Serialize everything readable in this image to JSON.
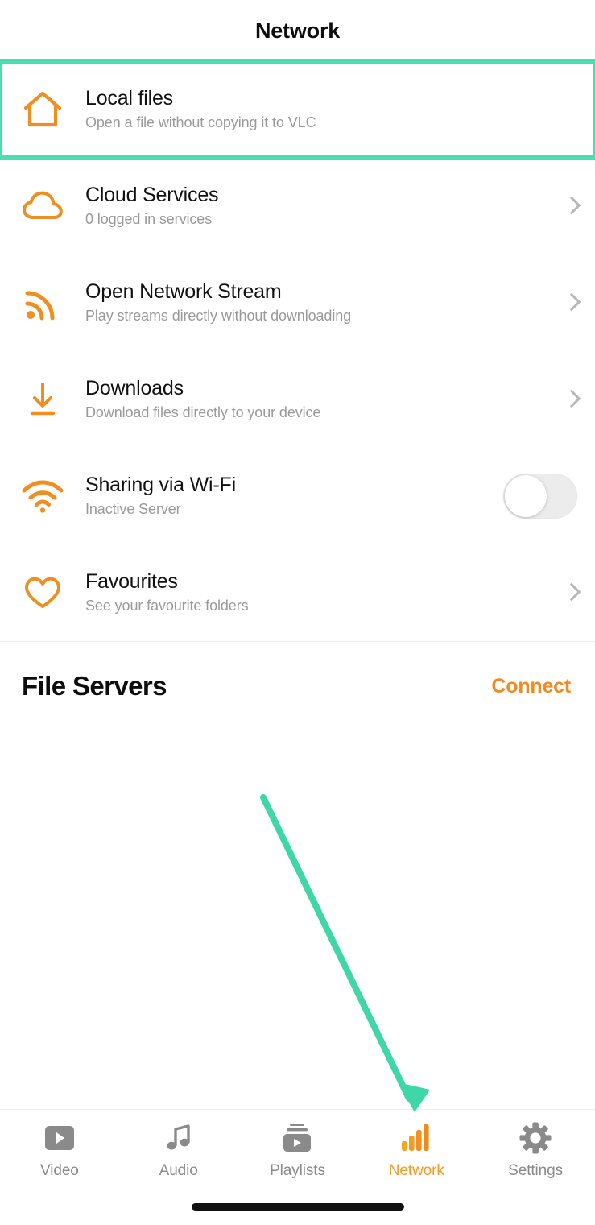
{
  "header": {
    "title": "Network"
  },
  "colors": {
    "accent_orange": "#f08b22",
    "icon_orange": "#ef8f22",
    "highlight_green": "#49dfb0",
    "muted_gray": "#9a9a9a",
    "tab_inactive": "#8a8a8a"
  },
  "list": {
    "items": [
      {
        "id": "local-files",
        "icon": "home-icon",
        "title": "Local files",
        "subtitle": "Open a file without copying it to VLC",
        "accessory": "none",
        "highlighted": true
      },
      {
        "id": "cloud-services",
        "icon": "cloud-icon",
        "title": "Cloud Services",
        "subtitle": "0 logged in services",
        "accessory": "chevron",
        "highlighted": false
      },
      {
        "id": "open-network-stream",
        "icon": "stream-icon",
        "title": "Open Network Stream",
        "subtitle": "Play streams directly without downloading",
        "accessory": "chevron",
        "highlighted": false
      },
      {
        "id": "downloads",
        "icon": "download-icon",
        "title": "Downloads",
        "subtitle": "Download files directly to your device",
        "accessory": "chevron",
        "highlighted": false
      },
      {
        "id": "sharing-via-wifi",
        "icon": "wifi-icon",
        "title": "Sharing via Wi-Fi",
        "subtitle": "Inactive Server",
        "accessory": "toggle",
        "toggle_state": "off",
        "highlighted": false
      },
      {
        "id": "favourites",
        "icon": "heart-icon",
        "title": "Favourites",
        "subtitle": "See your favourite folders",
        "accessory": "chevron",
        "highlighted": false
      }
    ]
  },
  "file_servers": {
    "title": "File Servers",
    "connect_label": "Connect"
  },
  "tabbar": {
    "tabs": [
      {
        "id": "video",
        "label": "Video",
        "icon": "video-icon",
        "active": false
      },
      {
        "id": "audio",
        "label": "Audio",
        "icon": "audio-note-icon",
        "active": false
      },
      {
        "id": "playlists",
        "label": "Playlists",
        "icon": "playlists-icon",
        "active": false
      },
      {
        "id": "network",
        "label": "Network",
        "icon": "signal-bars-icon",
        "active": true
      },
      {
        "id": "settings",
        "label": "Settings",
        "icon": "gear-icon",
        "active": false
      }
    ]
  },
  "annotation": {
    "arrow_color": "#3fd6a8",
    "highlight_target": "Local files",
    "arrow_points_to": "Network"
  }
}
